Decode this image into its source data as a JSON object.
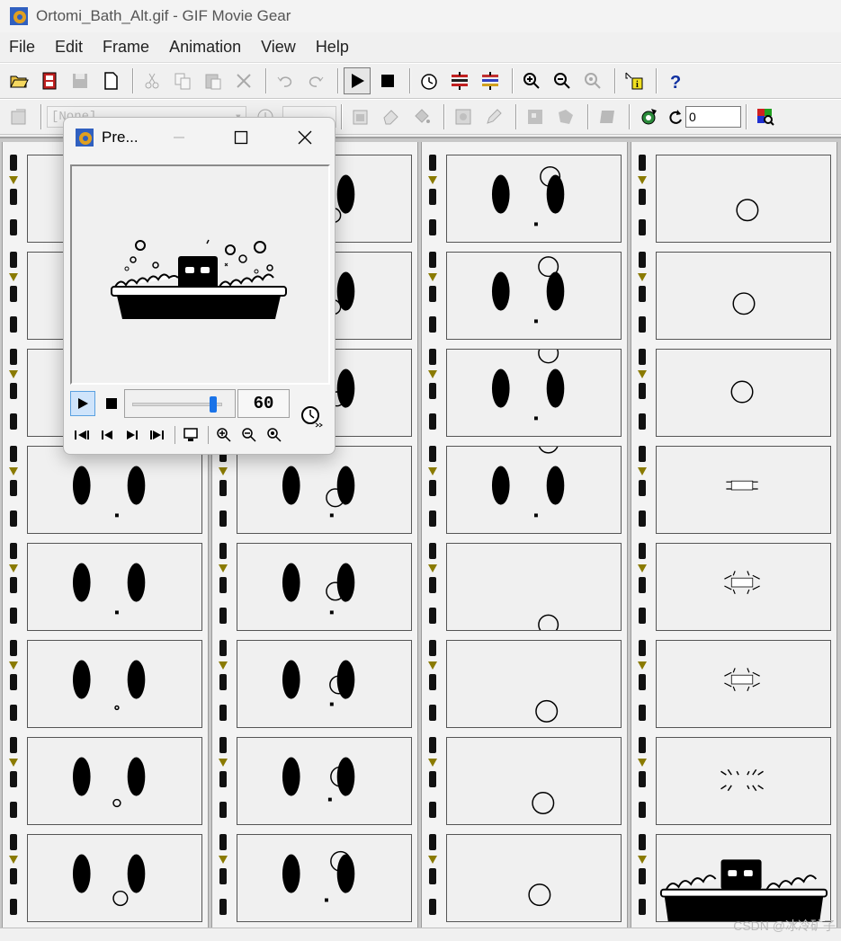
{
  "window": {
    "title": "Ortomi_Bath_Alt.gif - GIF Movie Gear"
  },
  "menu": [
    "File",
    "Edit",
    "Frame",
    "Animation",
    "View",
    "Help"
  ],
  "toolbar2": {
    "palette_combo": "[None]",
    "loop_value": "0"
  },
  "preview": {
    "title": "Pre...",
    "rate": "60",
    "slider_fraction": 0.88
  },
  "watermark": "CSDN @冰冷矿子",
  "icons": {
    "open": "open-folder-icon",
    "play": "play-icon",
    "stop": "stop-icon",
    "help": "help-icon"
  }
}
